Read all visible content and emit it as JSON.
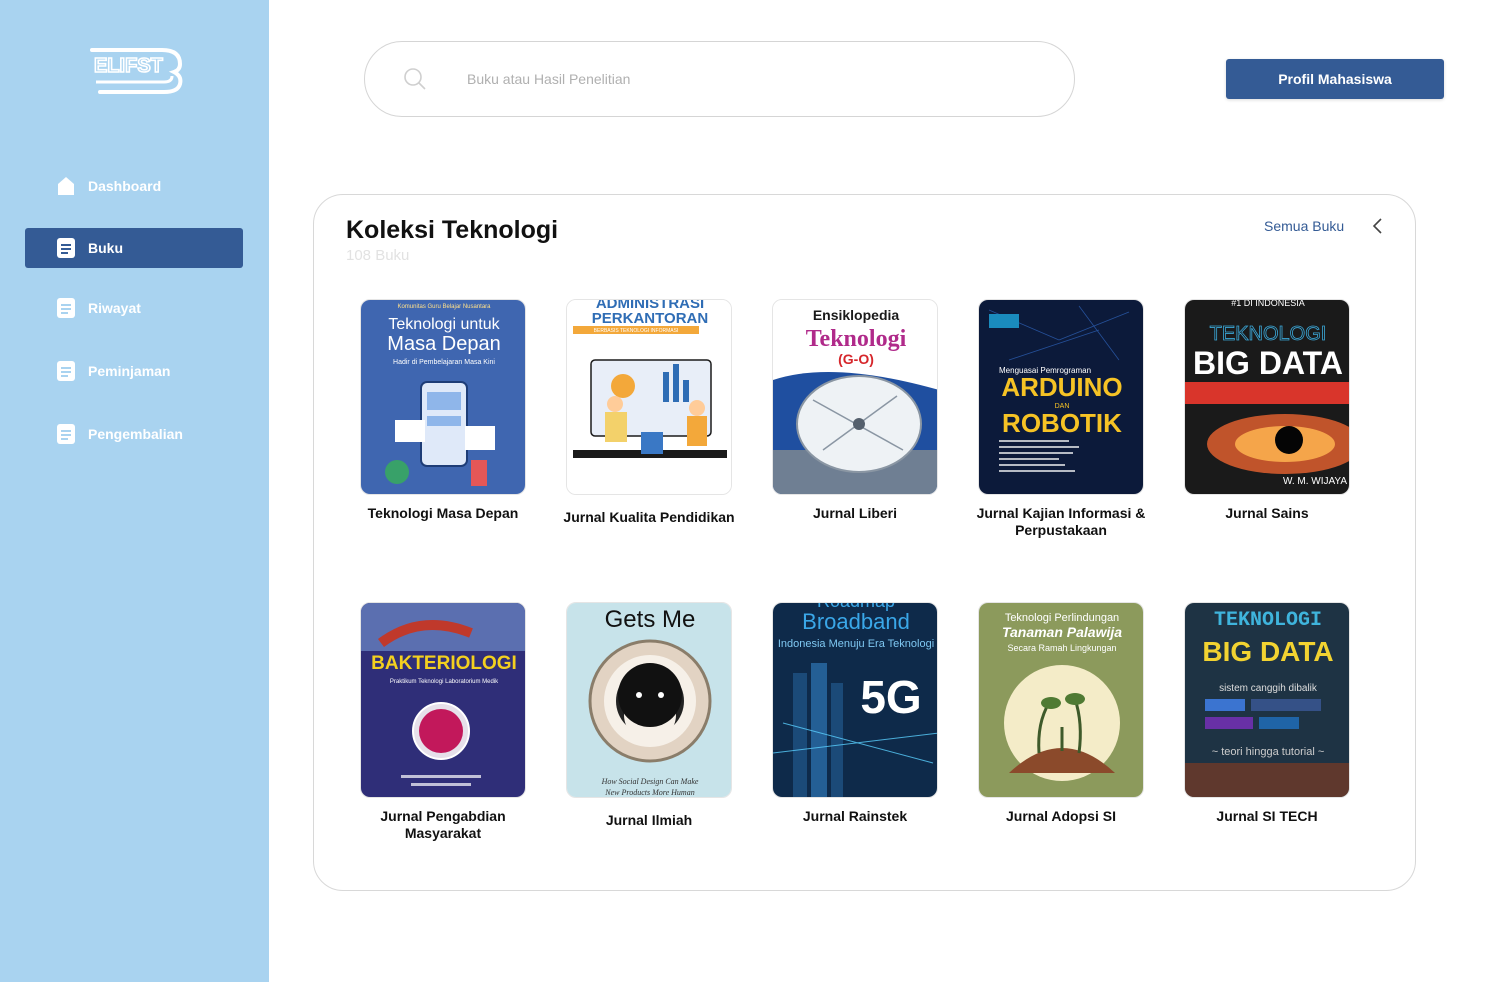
{
  "app": {
    "logo_text": "ELIFST"
  },
  "sidebar": {
    "items": [
      {
        "label": "Dashboard",
        "icon": "home-icon",
        "active": false
      },
      {
        "label": "Buku",
        "icon": "document-icon",
        "active": true
      },
      {
        "label": "Riwayat",
        "icon": "document-icon",
        "active": false
      },
      {
        "label": "Peminjaman",
        "icon": "document-icon",
        "active": false
      },
      {
        "label": "Pengembalian",
        "icon": "document-icon",
        "active": false
      }
    ]
  },
  "header": {
    "search_placeholder": "Buku atau Hasil Penelitian",
    "profile_button": "Profil Mahasiswa"
  },
  "collection": {
    "title": "Koleksi Teknologi",
    "count": "108 Buku",
    "see_all": "Semua Buku",
    "books": [
      {
        "title": "Teknologi Masa Depan",
        "cover": {
          "bg": "#3f66b0",
          "accent": "#8fb6ea",
          "header": "Komunitas Guru Belajar Nusantara",
          "line1": "Teknologi untuk",
          "line2": "Masa Depan",
          "line3": "Hadir di Pembelajaran Masa Kini"
        }
      },
      {
        "title": "Jurnal Kualita Pendidikan",
        "cover": {
          "bg": "#ffffff",
          "accent": "#2f6db5",
          "header": "ADMINISTRASI",
          "line1": "PERKANTORAN",
          "line2": "BERBASIS TEKNOLOGI INFORMASI",
          "line3": ""
        }
      },
      {
        "title": "Jurnal Liberi",
        "cover": {
          "bg": "#ffffff",
          "accent": "#b02a8a",
          "header": "Ensiklopedia",
          "line1": "Teknologi",
          "line2": "(G-O)",
          "line3": ""
        }
      },
      {
        "title": "Jurnal Kajian Informasi & Perpustakaan",
        "cover": {
          "bg": "#0c1a3a",
          "accent": "#f6c325",
          "header": "Menguasai Pemrograman",
          "line1": "ARDUINO",
          "line2": "DAN",
          "line3": "ROBOTIK"
        }
      },
      {
        "title": "Jurnal Sains",
        "cover": {
          "bg": "#1a1a1a",
          "accent": "#d9352b",
          "header": "#1 DI INDONESIA",
          "line1": "TEKNOLOGI",
          "line2": "BIG DATA",
          "line3": "W. M. WIJAYA"
        }
      },
      {
        "title": "Jurnal Pengabdian Masyarakat",
        "cover": {
          "bg": "#2f2e78",
          "accent": "#f3d01f",
          "header": "",
          "line1": "BAKTERIOLOGI",
          "line2": "Praktikum Teknologi Laboratorium Medik",
          "line3": ""
        }
      },
      {
        "title": "Jurnal Ilmiah",
        "cover": {
          "bg": "#c7e3ea",
          "accent": "#111111",
          "header": "Gets Me",
          "line1": "How Social Design Can Make",
          "line2": "New Products More Human",
          "line3": ""
        }
      },
      {
        "title": "Jurnal Rainstek",
        "cover": {
          "bg": "#0e2a4a",
          "accent": "#3aa7e8",
          "header": "Roadmap",
          "line1": "Broadband",
          "line2": "Indonesia Menuju Era Teknologi",
          "line3": "5G"
        }
      },
      {
        "title": "Jurnal Adopsi SI",
        "cover": {
          "bg": "#8c9a5c",
          "accent": "#ffffff",
          "header": "Teknologi Perlindungan",
          "line1": "Tanaman Palawija",
          "line2": "Secara Ramah Lingkungan",
          "line3": ""
        }
      },
      {
        "title": "Jurnal SI TECH",
        "cover": {
          "bg": "#1e3344",
          "accent": "#f2d331",
          "header": "TEKNOLOGI",
          "line1": "BIG DATA",
          "line2": "sistem canggih dibalik",
          "line3": "~ teori hingga tutorial ~"
        }
      }
    ]
  },
  "icons": {
    "search": "search-icon",
    "back": "chevron-left-icon"
  }
}
